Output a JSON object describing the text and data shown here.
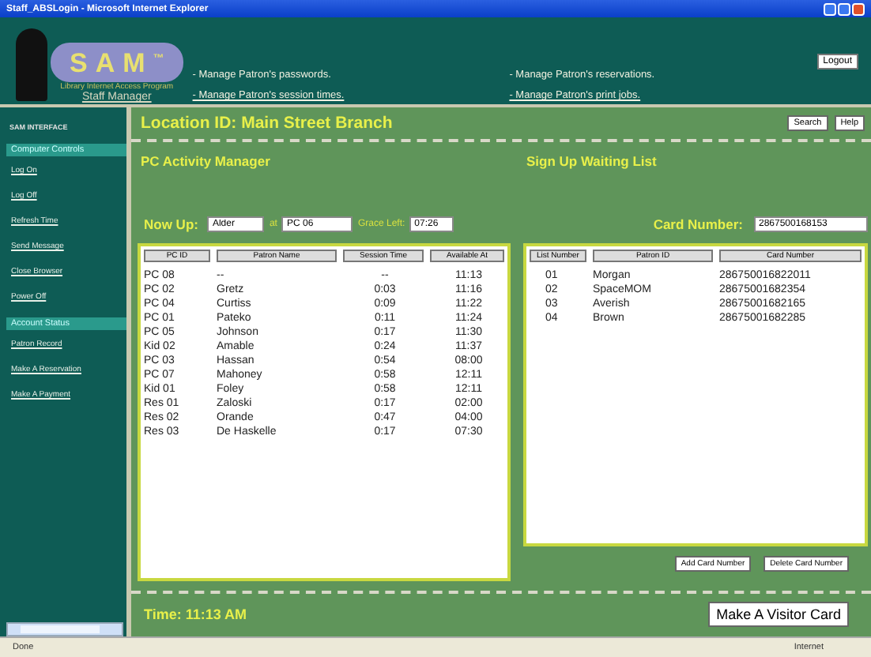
{
  "window": {
    "title": "Staff_ABSLogin - Microsoft Internet Explorer"
  },
  "header": {
    "logo": "SAM",
    "logo_mark": "™",
    "tagline": "Library Internet Access Program",
    "subtitle": "Staff Manager",
    "links": [
      "- Manage Patron's passwords.",
      "- Manage Patron's reservations.",
      "- Manage Patron's session times.",
      "- Manage Patron's print jobs."
    ],
    "logout": "Logout"
  },
  "sidebar": {
    "heading": "SAM INTERFACE",
    "sections": [
      {
        "title": "Computer Controls",
        "items": [
          "Log On",
          "Log Off",
          "Refresh Time",
          "Send Message",
          "Close Browser",
          "Power Off"
        ]
      },
      {
        "title": "Account Status",
        "items": [
          "Patron Record",
          "Make A Reservation",
          "Make A Payment"
        ]
      }
    ]
  },
  "location": "Location ID: Main Street Branch",
  "top_buttons": [
    "Search",
    "Help"
  ],
  "pc_activity": {
    "title": "PC Activity Manager",
    "now_up_label": "Now Up:",
    "now_up_value": "Alder",
    "at_label": "at",
    "pc_value": "PC 06",
    "grace_label": "Grace Left:",
    "grace_value": "07:26",
    "columns": [
      "PC ID",
      "Patron Name",
      "Session Time",
      "Available At"
    ],
    "rows": [
      [
        "PC 08",
        "--",
        "--",
        "11:13"
      ],
      [
        "PC 02",
        "Gretz",
        "0:03",
        "11:16"
      ],
      [
        "PC 04",
        "Curtiss",
        "0:09",
        "11:22"
      ],
      [
        "PC 01",
        "Pateko",
        "0:11",
        "11:24"
      ],
      [
        "PC 05",
        "Johnson",
        "0:17",
        "11:30"
      ],
      [
        "Kid 02",
        "Amable",
        "0:24",
        "11:37"
      ],
      [
        "PC 03",
        "Hassan",
        "0:54",
        "08:00"
      ],
      [
        "PC 07",
        "Mahoney",
        "0:58",
        "12:11"
      ],
      [
        "Kid 01",
        "Foley",
        "0:58",
        "12:11"
      ],
      [
        "Res 01",
        "Zaloski",
        "0:17",
        "02:00"
      ],
      [
        "Res 02",
        "Orande",
        "0:47",
        "04:00"
      ],
      [
        "Res 03",
        "De Haskelle",
        "0:17",
        "07:30"
      ]
    ]
  },
  "waiting_list": {
    "title": "Sign Up Waiting List",
    "card_label": "Card Number:",
    "card_value": "2867500168153",
    "columns": [
      "List Number",
      "Patron ID",
      "Card Number"
    ],
    "rows": [
      [
        "01",
        "Morgan",
        "286750016822011"
      ],
      [
        "02",
        "SpaceMOM",
        "28675001682354"
      ],
      [
        "03",
        "Averish",
        "28675001682165"
      ],
      [
        "04",
        "Brown",
        "28675001682285"
      ]
    ],
    "buttons": [
      "Add Card Number",
      "Delete Card Number"
    ]
  },
  "footer": {
    "time": "Time: 11:13 AM",
    "visitor_button": "Make A Visitor Card"
  },
  "status_bar": {
    "left": "Done",
    "right": "Internet"
  }
}
